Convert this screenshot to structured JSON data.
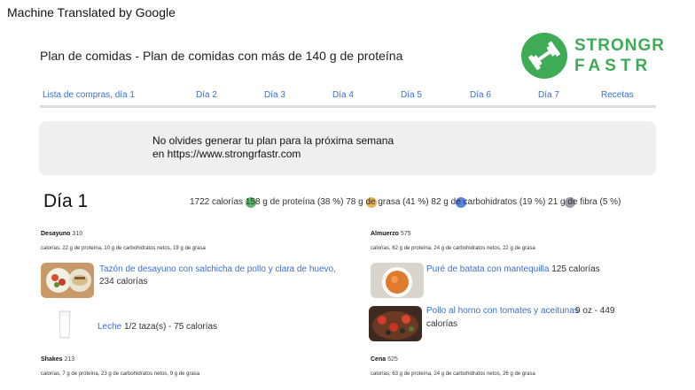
{
  "banner": "Machine Translated by Google",
  "title": "Plan de comidas - Plan de comidas con más de 140 g de proteína",
  "logo": {
    "line1": "STRONGR",
    "line2": "FASTR",
    "color": "#3fab57"
  },
  "nav": [
    "Lista de compras, día 1",
    "Día 2",
    "Día 3",
    "Día 4",
    "Día 5",
    "Día 6",
    "Día 7",
    "Recetas"
  ],
  "reminder": {
    "line1": "No olvides generar tu plan para la próxima semana",
    "line2": "en https://www.strongrfastr.com"
  },
  "day": {
    "title": "Día 1",
    "macros": "1722 calorías 158 g de proteína (38 %) 78 g de grasa (41 %) 82 g de carbohidratos (19 %) 21 g de fibra (5 %)",
    "dot_colors": [
      "#3fab57",
      "#e8a53b",
      "#3a6fd8",
      "#8a8a9a"
    ]
  },
  "meals": {
    "breakfast": {
      "name": "Desayuno",
      "calories": "310",
      "macros": "calorías, 22 g de proteína, 10 g de carbohidratos netos, 19 g de grasa",
      "items": [
        {
          "link": "Tazón de desayuno con salchicha de pollo y clara de huevo,",
          "detail": "234 calorías"
        },
        {
          "link": "Leche",
          "detail": "1/2 taza(s) - 75 calorías"
        }
      ]
    },
    "lunch": {
      "name": "Almuerzo",
      "calories": "575",
      "macros": "calorías, 62 g de proteína, 24 g de carbohidratos netos, 22 g de grasa",
      "items": [
        {
          "link": "Puré de batata con mantequilla",
          "detail": "125 calorías"
        },
        {
          "link": "Pollo al horno con tomates y aceitunas",
          "detail": "9 oz - 449",
          "detail2": "calorías"
        }
      ]
    },
    "shakes": {
      "name": "Shakes",
      "calories": "213",
      "macros": "calorías, 7 g de proteína, 23 g de carbohidratos netos, 9 g de grasa"
    },
    "dinner": {
      "name": "Cena",
      "calories": "625",
      "macros": "calorías, 63 g de proteína, 24 g de carbohidratos netos, 26 g de grasa"
    }
  }
}
